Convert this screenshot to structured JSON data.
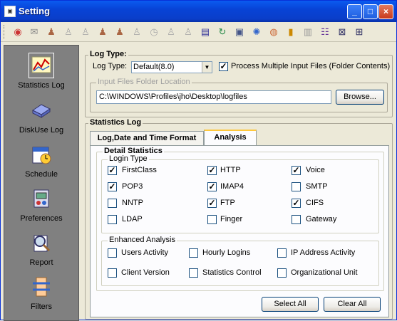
{
  "window": {
    "title": "Setting",
    "buttons": [
      "_",
      "□",
      "×"
    ]
  },
  "toolbar": {
    "icons": [
      "globe-icon",
      "envelope-icon",
      "user-hammer-icon",
      "dotted-user-icon",
      "dotted-user-icon",
      "user-tool-icon",
      "user-edit-icon",
      "user-lock-icon",
      "clock-icon",
      "dotted-user-icon",
      "dotted-user-icon",
      "list-icon",
      "refresh-icon",
      "image-icon",
      "network-icon",
      "globe-chart-icon",
      "bar-chart-icon",
      "document-icon",
      "checklist-icon",
      "window-close-icon",
      "window-settings-icon"
    ]
  },
  "sidebar": {
    "items": [
      {
        "label": "Statistics Log",
        "icon": "chart-icon"
      },
      {
        "label": "DiskUse Log",
        "icon": "disk-icon"
      },
      {
        "label": "Schedule",
        "icon": "calendar-icon"
      },
      {
        "label": "Preferences",
        "icon": "preferences-icon"
      },
      {
        "label": "Report",
        "icon": "report-icon"
      },
      {
        "label": "Filters",
        "icon": "filter-icon"
      }
    ]
  },
  "logtype": {
    "group_title": "Log Type:",
    "label": "Log Type:",
    "selected": "Default(8.0)",
    "multi_label": "Process Multiple Input Files (Folder Contents)",
    "multi_checked": true,
    "folder_title": "Input Files Folder Location",
    "folder_value": "C:\\WINDOWS\\Profiles\\jho\\Desktop\\logfiles",
    "browse_label": "Browse..."
  },
  "stats": {
    "group_title": "Statistics Log",
    "tabs": [
      "Log,Date and Time Format",
      "Analysis"
    ],
    "detail_title": "Detail Statistics",
    "login_title": "Login Type",
    "logins": [
      {
        "label": "FirstClass",
        "checked": true
      },
      {
        "label": "HTTP",
        "checked": true
      },
      {
        "label": "Voice",
        "checked": true
      },
      {
        "label": "POP3",
        "checked": true
      },
      {
        "label": "IMAP4",
        "checked": true
      },
      {
        "label": "SMTP",
        "checked": false
      },
      {
        "label": "NNTP",
        "checked": false
      },
      {
        "label": "FTP",
        "checked": true
      },
      {
        "label": "CIFS",
        "checked": true
      },
      {
        "label": "LDAP",
        "checked": false
      },
      {
        "label": "Finger",
        "checked": false
      },
      {
        "label": "Gateway",
        "checked": false
      }
    ],
    "enhanced_title": "Enhanced Analysis",
    "enhanced": [
      {
        "label": "Users Activity",
        "checked": false
      },
      {
        "label": "Hourly Logins",
        "checked": false
      },
      {
        "label": "IP Address Activity",
        "checked": false
      },
      {
        "label": "Client Version",
        "checked": false
      },
      {
        "label": "Statistics Control",
        "checked": false
      },
      {
        "label": "Organizational Unit",
        "checked": false
      }
    ],
    "select_all": "Select All",
    "clear_all": "Clear All"
  }
}
